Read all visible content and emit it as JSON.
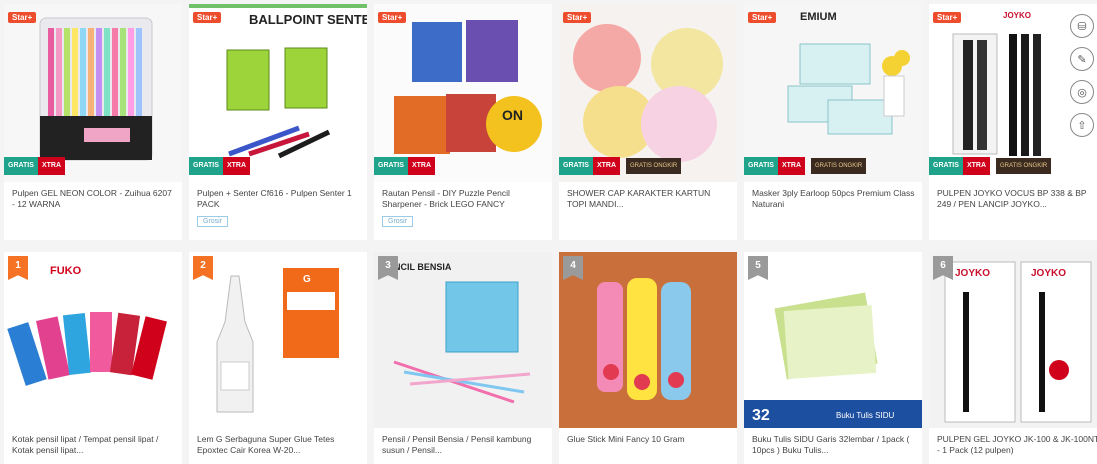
{
  "badges": {
    "star": "Star+",
    "gratis": "GRATIS",
    "xtra": "XTRA",
    "dark_tag": "GRATIS ONGKIR"
  },
  "grosir": "Grosir",
  "products_row1": [
    {
      "title": "Pulpen GEL NEON COLOR - Zuihua 6207 - 12 WARNA",
      "grosir": false,
      "dark": false
    },
    {
      "title": "Pulpen + Senter Cf616 - Pulpen Senter 1 PACK",
      "grosir": true,
      "dark": false,
      "overlay": "BALLPOINT SENTER"
    },
    {
      "title": "Rautan Pensil - DIY Puzzle Pencil Sharpener - Brick LEGO FANCY",
      "grosir": true,
      "dark": false
    },
    {
      "title": "SHOWER CAP KARAKTER KARTUN TOPI MANDI...",
      "grosir": false,
      "dark": true
    },
    {
      "title": "Masker 3ply Earloop 50pcs Premium Class Naturani",
      "grosir": false,
      "dark": true,
      "overlay": "EMIUM"
    },
    {
      "title": "PULPEN JOYKO VOCUS BP 338 & BP 249 / PEN LANCIP JOYKO...",
      "grosir": false,
      "dark": true,
      "overlay": "JOYKO"
    }
  ],
  "products_row2": [
    {
      "rank": "1",
      "title": "Kotak pensil lipat / Tempat pensil lipat / Kotak pensil lipat...",
      "overlay": "FUKO"
    },
    {
      "rank": "2",
      "title": "Lem G Serbaguna Super Glue Tetes Epoxtec Cair Korea W-20...",
      "overlay": "G"
    },
    {
      "rank": "3",
      "title": "Pensil / Pensil Bensia / Pensil kambung susun / Pensil...",
      "overlay": "PENCIL BENSIA"
    },
    {
      "rank": "4",
      "title": "Glue Stick Mini Fancy 10 Gram"
    },
    {
      "rank": "5",
      "title": "Buku Tulis SIDU Garis 32lembar / 1pack ( 10pcs ) Buku Tulis...",
      "overlay": "32",
      "overlay2": "Buku Tulis SIDU"
    },
    {
      "rank": "6",
      "title": "PULPEN GEL JOYKO JK-100 & JK-100NT - 1 Pack (12 pulpen)",
      "overlay": "JOYKO"
    }
  ],
  "side_labels": [
    "",
    "",
    "",
    ""
  ]
}
